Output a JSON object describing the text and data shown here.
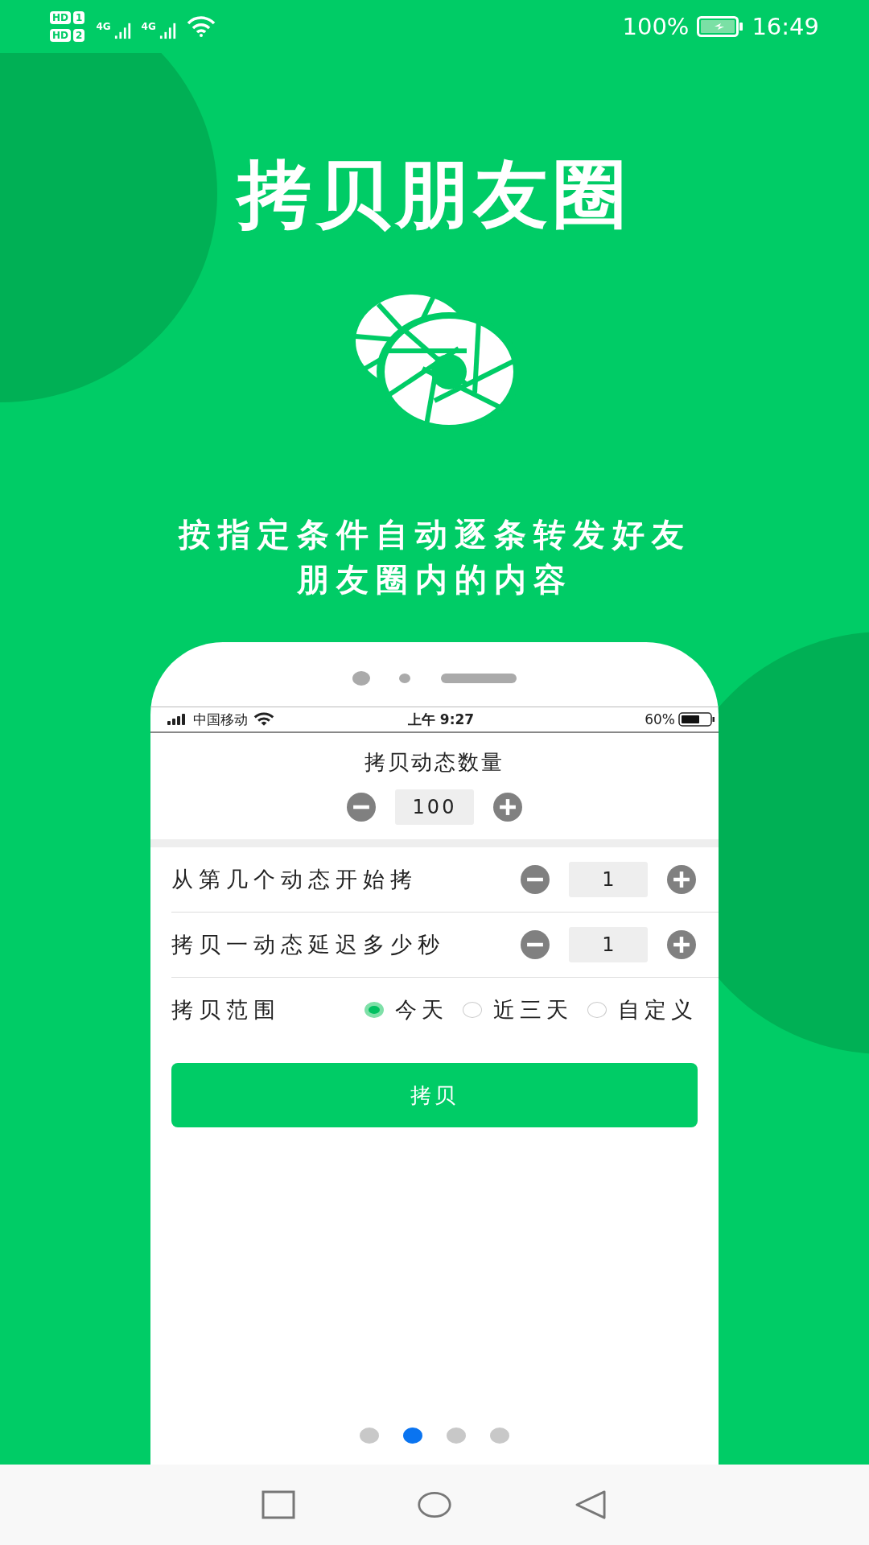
{
  "status_bar": {
    "sim_badges": [
      {
        "label": "HD",
        "slot": "1"
      },
      {
        "label": "HD",
        "slot": "2"
      }
    ],
    "networks": [
      "4G",
      "4G"
    ],
    "battery": "100%",
    "time": "16:49"
  },
  "title": "拷贝朋友圈",
  "subtitle_lines": [
    "按指定条件自动逐条转发好友",
    "朋友圈内的内容"
  ],
  "phone": {
    "status_bar": {
      "carrier": "中国移动",
      "time": "上午 9:27",
      "battery": "60%"
    },
    "count_section": {
      "label": "拷贝动态数量",
      "value": "100"
    },
    "rows": [
      {
        "kind": "stepper",
        "label": "从第几个动态开始拷",
        "value": "1"
      },
      {
        "kind": "stepper",
        "label": "拷贝一动态延迟多少秒",
        "value": "1"
      },
      {
        "kind": "radio",
        "label": "拷贝范围",
        "options": [
          {
            "label": "今天",
            "selected": true
          },
          {
            "label": "近三天",
            "selected": false
          },
          {
            "label": "自定义",
            "selected": false
          }
        ]
      }
    ],
    "button": "拷贝"
  },
  "page_dots": [
    {
      "selected": false
    },
    {
      "selected": true
    },
    {
      "selected": false
    },
    {
      "selected": false
    }
  ]
}
